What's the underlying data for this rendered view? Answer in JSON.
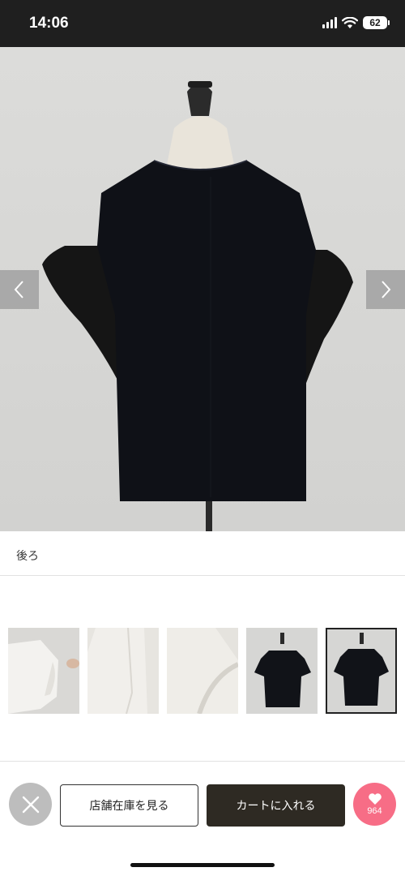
{
  "status_bar": {
    "time": "14:06",
    "battery": "62"
  },
  "gallery": {
    "caption": "後ろ",
    "current_index": 5,
    "total": 5
  },
  "thumbnails": [
    {
      "name": "white-shirt-sleeve"
    },
    {
      "name": "white-shirt-closeup"
    },
    {
      "name": "white-shirt-frill"
    },
    {
      "name": "black-shirt-front"
    },
    {
      "name": "black-shirt-back",
      "selected": true
    }
  ],
  "actions": {
    "store_stock": "店舗在庫を見る",
    "add_to_cart": "カートに入れる",
    "favorite_count": "964"
  },
  "colors": {
    "cart_button": "#2e2a23",
    "favorite_button": "#f76d86",
    "close_button": "#bdbdbd"
  }
}
